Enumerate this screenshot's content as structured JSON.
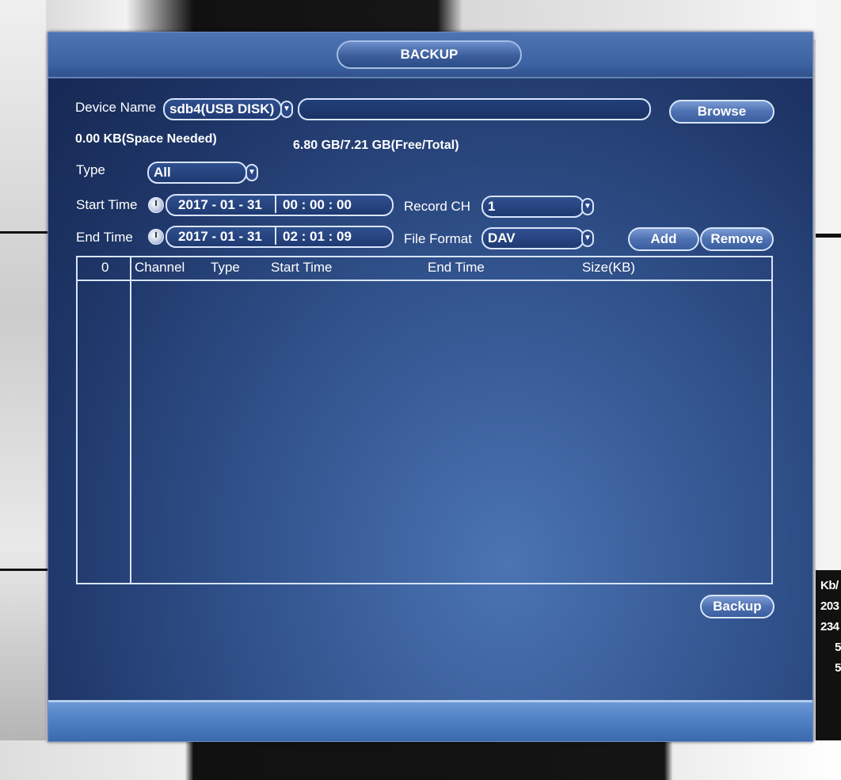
{
  "dialog": {
    "title": "BACKUP"
  },
  "device": {
    "label": "Device Name",
    "selected": "sdb4(USB DISK)",
    "path_value": "",
    "browse_label": "Browse",
    "space_needed": "0.00 KB(Space Needed)",
    "free_total": "6.80 GB/7.21 GB(Free/Total)"
  },
  "type": {
    "label": "Type",
    "selected": "All"
  },
  "start_time": {
    "label": "Start Time",
    "date": "2017 - 01 - 31",
    "time": "00 : 00 : 00"
  },
  "end_time": {
    "label": "End Time",
    "date": "2017 - 01 - 31",
    "time": "02 : 01 : 09"
  },
  "record_ch": {
    "label": "Record CH",
    "selected": "1"
  },
  "file_format": {
    "label": "File Format",
    "selected": "DAV"
  },
  "buttons": {
    "add": "Add",
    "remove": "Remove",
    "backup": "Backup"
  },
  "table": {
    "columns": [
      "0",
      "Channel",
      "Type",
      "Start Time",
      "End Time",
      "Size(KB)"
    ],
    "rows": []
  },
  "side_stats": [
    "Kb/",
    "203",
    "234",
    "5",
    "5"
  ],
  "colors": {
    "dialog_bg": "#31528c",
    "border": "#d8e5fb",
    "text": "#ffffff"
  }
}
